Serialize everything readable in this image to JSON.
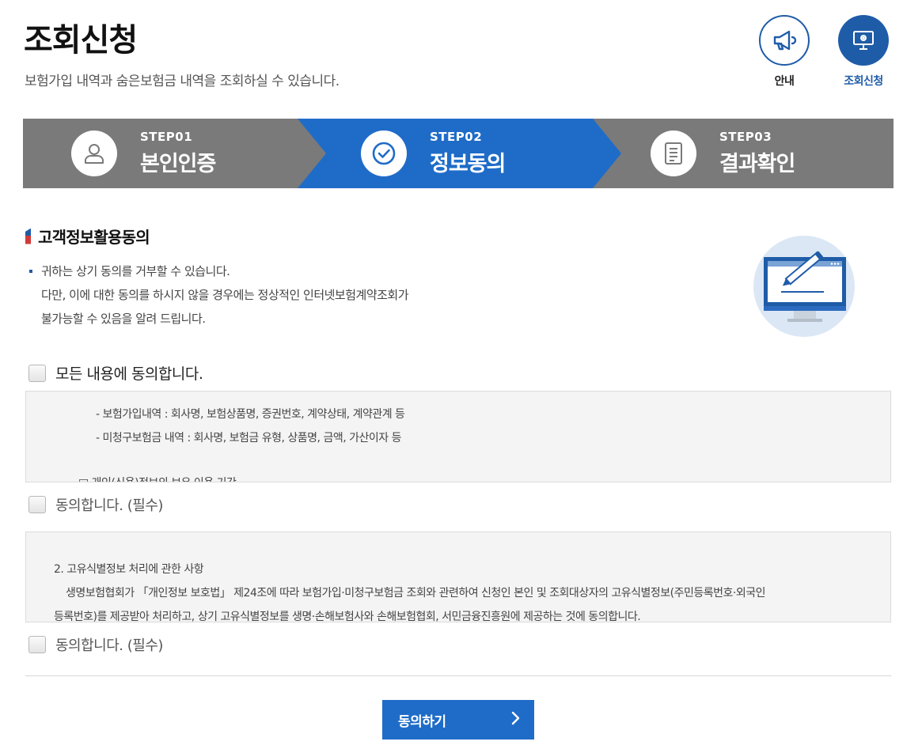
{
  "header": {
    "title": "조회신청",
    "subtitle": "보험가입 내역과 숨은보험금 내역을 조회하실 수 있습니다.",
    "buttons": [
      {
        "label": "안내",
        "icon": "megaphone-icon"
      },
      {
        "label": "조회신청",
        "icon": "monitor-icon"
      }
    ]
  },
  "steps": [
    {
      "number": "STEP01",
      "name": "본인인증",
      "icon": "user-icon",
      "active": false
    },
    {
      "number": "STEP02",
      "name": "정보동의",
      "icon": "check-circle-icon",
      "active": true
    },
    {
      "number": "STEP03",
      "name": "결과확인",
      "icon": "document-icon",
      "active": false
    }
  ],
  "colors": {
    "primary": "#1f5ca8",
    "active_step": "#1f6cc8",
    "inactive_step": "#7a7a7a",
    "accent_red": "#d23a3a"
  },
  "section": {
    "title": "고객정보활용동의",
    "notice_lines": [
      "귀하는 상기 동의를 거부할 수 있습니다.",
      "다만, 이에 대한 동의를 하시지 않을 경우에는 정상적인 인터넷보험계약조회가",
      "불가능할 수 있음을 알려 드립니다."
    ]
  },
  "agree_all": {
    "label": "모든 내용에 동의합니다.",
    "checked": false
  },
  "terms1": {
    "lines": [
      "- 보험가입내역 : 회사명, 보험상품명, 증권번호, 계약상태, 계약관계 등",
      "- 미청구보험금 내역 : 회사명, 보험금 유형, 상품명, 금액, 가산이자 등",
      "□ 개인(신용)정보의 보유·이용 기간"
    ],
    "agree_label": "동의합니다. (필수)",
    "checked": false
  },
  "terms2": {
    "heading": "2. 고유식별정보 처리에 관한 사항",
    "lines": [
      "생명보험협회가 「개인정보 보호법」 제24조에 따라 보험가입·미청구보험금 조회와 관련하여 신청인 본인 및 조회대상자의 고유식별정보(주민등록번호·외국인",
      "등록번호)를 제공받아 처리하고, 상기 고유식별정보를 생명·손해보험사와 손해보험협회, 서민금융진흥원에 제공하는 것에 동의합니다."
    ],
    "agree_label": "동의합니다. (필수)",
    "checked": false
  },
  "submit": {
    "label": "동의하기"
  }
}
